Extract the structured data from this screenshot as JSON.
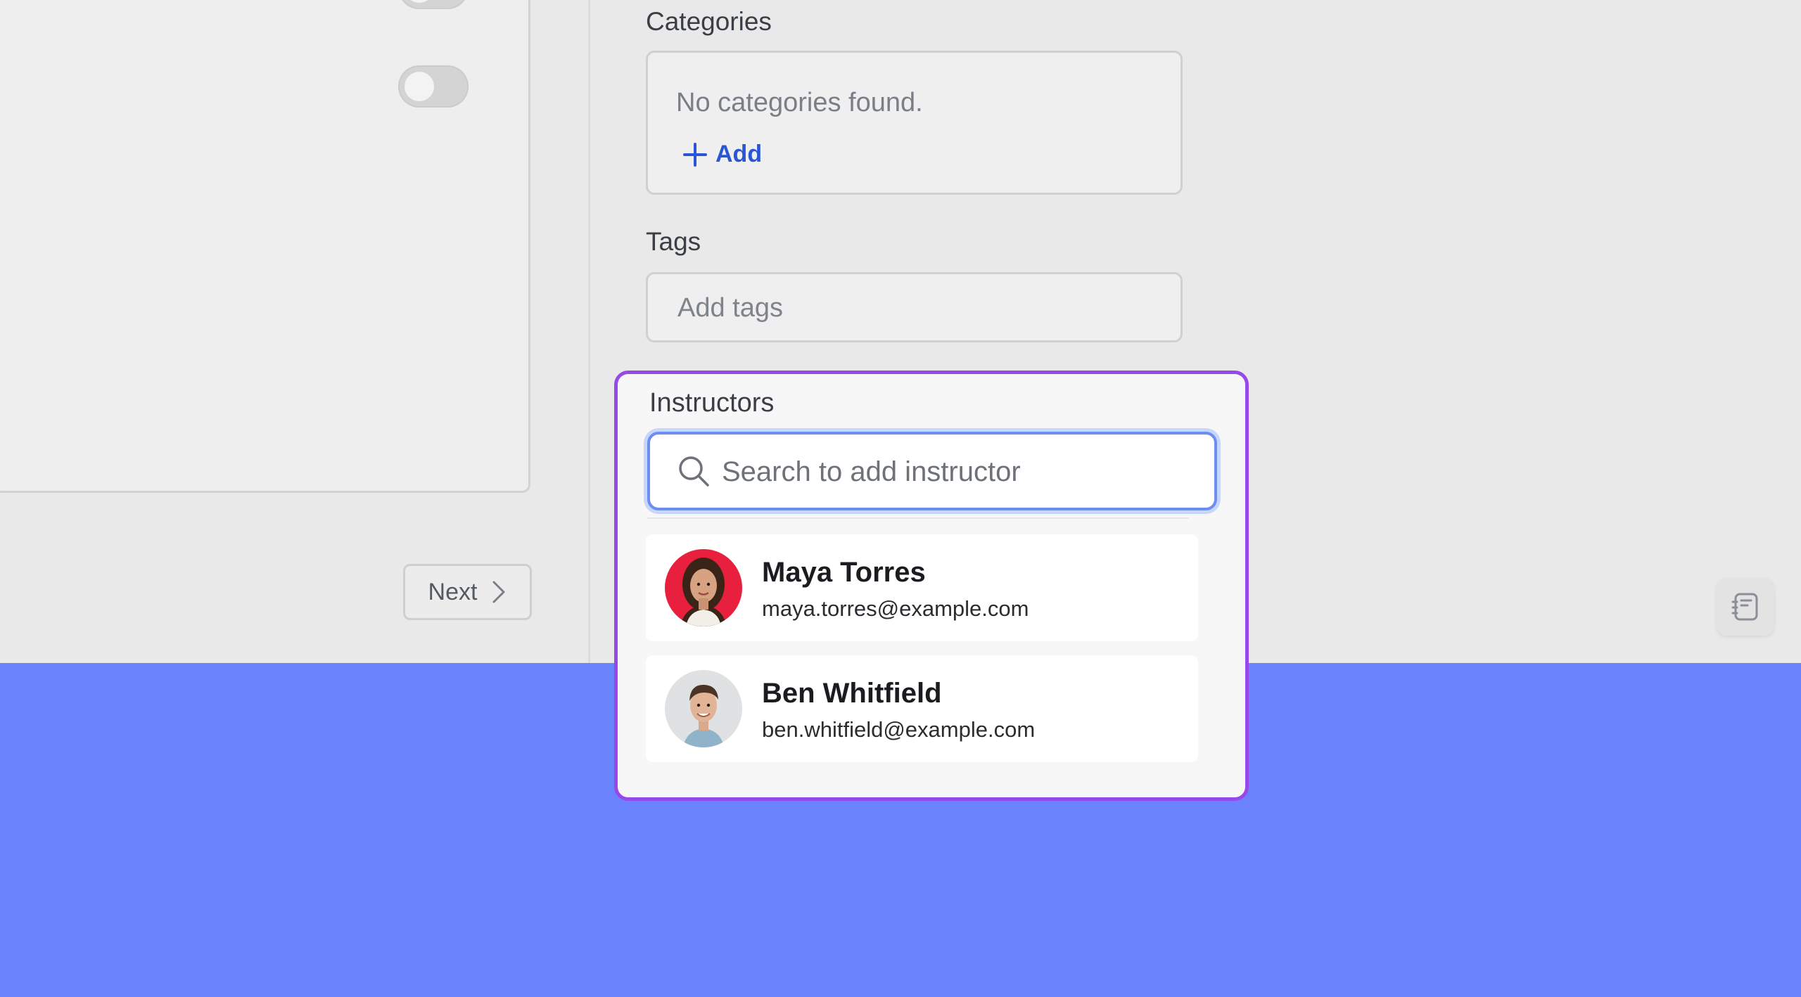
{
  "form": {
    "categories": {
      "label": "Categories",
      "empty_text": "No categories found.",
      "add_label": "Add"
    },
    "tags": {
      "label": "Tags",
      "placeholder": "Add tags"
    },
    "instructors": {
      "label": "Instructors",
      "search_placeholder": "Search to add instructor",
      "results": [
        {
          "name": "Maya Torres",
          "email": "maya.torres@example.com"
        },
        {
          "name": "Ben Whitfield",
          "email": "ben.whitfield@example.com"
        }
      ]
    }
  },
  "navigation": {
    "next_label": "Next"
  },
  "colors": {
    "highlight_border": "#9748ea",
    "focus_ring": "#6b8ff0",
    "link_blue": "#2a56d6",
    "backdrop_blue": "#6a83fd"
  },
  "icons": {
    "search": "search-icon",
    "add": "plus-icon",
    "next": "chevron-right-icon",
    "notes": "notebook-icon",
    "info": "info-icon"
  }
}
